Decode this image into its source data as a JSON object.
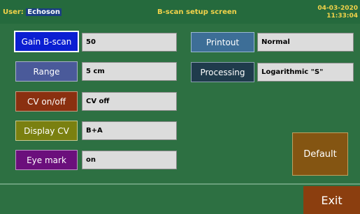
{
  "header": {
    "user_label": "User:",
    "user_name": "Echoson",
    "title": "B-scan setup screen",
    "date": "04-03-2020",
    "time": "11:33:04"
  },
  "left_settings": [
    {
      "label": "Gain B-scan",
      "value": "50",
      "color": "#0b1fd2"
    },
    {
      "label": "Range",
      "value": "5 cm",
      "color": "#4a5a9a"
    },
    {
      "label": "CV on/off",
      "value": "CV off",
      "color": "#8a3010"
    },
    {
      "label": "Display CV",
      "value": "B+A",
      "color": "#7a8010"
    },
    {
      "label": "Eye mark",
      "value": "on",
      "color": "#6b0f7c"
    }
  ],
  "right_settings": [
    {
      "label": "Printout",
      "value": "Normal",
      "color": "#3d6e97"
    },
    {
      "label": "Processing",
      "value": "Logarithmic \"S\"",
      "color": "#1f3b4c"
    }
  ],
  "buttons": {
    "default": "Default",
    "exit": "Exit"
  },
  "colors": {
    "background": "#2f6f46",
    "header_text": "#f2d34a",
    "default_button": "#845512",
    "exit_button": "#8b3e0f"
  }
}
